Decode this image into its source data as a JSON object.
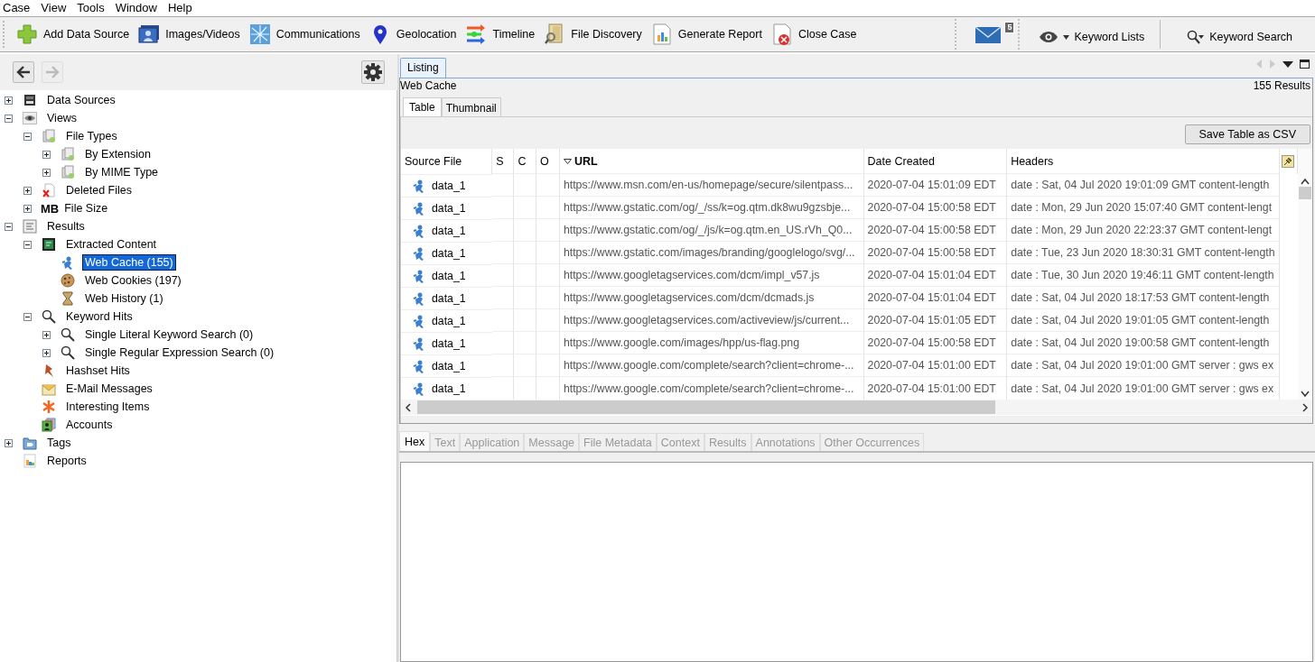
{
  "menu": [
    "Case",
    "View",
    "Tools",
    "Window",
    "Help"
  ],
  "toolbar": [
    {
      "label": "Add Data Source",
      "kind": "add"
    },
    {
      "label": "Images/Videos",
      "kind": "images"
    },
    {
      "label": "Communications",
      "kind": "comms"
    },
    {
      "label": "Geolocation",
      "kind": "pin"
    },
    {
      "label": "Timeline",
      "kind": "timeline"
    },
    {
      "label": "File Discovery",
      "kind": "discovery"
    },
    {
      "label": "Generate Report",
      "kind": "report"
    },
    {
      "label": "Close Case",
      "kind": "close"
    }
  ],
  "notifications": {
    "count": "5"
  },
  "keyword_lists": {
    "label": "Keyword Lists"
  },
  "keyword_search": {
    "label": "Keyword Search"
  },
  "nav": {
    "back": {
      "disabled": false
    },
    "forward": {
      "disabled": true
    }
  },
  "tree": [
    {
      "label": "Data Sources",
      "kind": "drive",
      "expanded": false,
      "selected": false
    },
    {
      "label": "Views",
      "kind": "eye",
      "expanded": true,
      "selected": false,
      "children": [
        {
          "label": "File Types",
          "kind": "filetypes",
          "expanded": true,
          "selected": false,
          "children": [
            {
              "label": "By Extension",
              "kind": "filetypes",
              "expanded": false,
              "selected": false
            },
            {
              "label": "By MIME Type",
              "kind": "filetypes",
              "expanded": false,
              "selected": false
            }
          ]
        },
        {
          "label": "Deleted Files",
          "kind": "deleted",
          "expanded": false,
          "selected": false
        },
        {
          "label": "File Size",
          "kind": "size",
          "badge": "MB",
          "expanded": false,
          "selected": false
        }
      ]
    },
    {
      "label": "Results",
      "kind": "results",
      "expanded": true,
      "selected": false,
      "children": [
        {
          "label": "Extracted Content",
          "kind": "extracted",
          "expanded": true,
          "selected": false,
          "children": [
            {
              "label": "Web Cache (155)",
              "kind": "webcache",
              "selected": true
            },
            {
              "label": "Web Cookies (197)",
              "kind": "cookie",
              "selected": false
            },
            {
              "label": "Web History (1)",
              "kind": "hourglass",
              "selected": false
            }
          ]
        },
        {
          "label": "Keyword Hits",
          "kind": "search",
          "expanded": true,
          "selected": false,
          "children": [
            {
              "label": "Single Literal Keyword Search (0)",
              "kind": "search",
              "expanded": false,
              "selected": false
            },
            {
              "label": "Single Regular Expression Search (0)",
              "kind": "search",
              "expanded": false,
              "selected": false
            }
          ]
        },
        {
          "label": "Hashset Hits",
          "kind": "pushpin",
          "selected": false
        },
        {
          "label": "E-Mail Messages",
          "kind": "mail",
          "selected": false
        },
        {
          "label": "Interesting Items",
          "kind": "asterisk",
          "selected": false
        },
        {
          "label": "Accounts",
          "kind": "accounts",
          "selected": false
        }
      ]
    },
    {
      "label": "Tags",
      "kind": "tags",
      "expanded": false,
      "selected": false
    },
    {
      "label": "Reports",
      "kind": "reports",
      "selected": false
    }
  ],
  "listing": {
    "tab": {
      "label": "Listing",
      "selected": true
    },
    "title": "Web Cache",
    "result_count": "155  Results",
    "view_tabs": [
      {
        "label": "Table",
        "selected": true
      },
      {
        "label": "Thumbnail",
        "selected": false
      }
    ],
    "save_button": "Save Table as CSV",
    "columns": [
      {
        "label": "Source File",
        "sorted": false
      },
      {
        "label": "S",
        "sorted": false
      },
      {
        "label": "C",
        "sorted": false
      },
      {
        "label": "O",
        "sorted": false
      },
      {
        "label": "URL",
        "sorted": true
      },
      {
        "label": "Date Created",
        "sorted": false
      },
      {
        "label": "Headers",
        "sorted": false
      }
    ],
    "rows": [
      {
        "source_file": "data_1",
        "url": "https://www.msn.com/en-us/homepage/secure/silentpass...",
        "date_created": "2020-07-04 15:01:09 EDT",
        "headers": "date : Sat, 04 Jul 2020 19:01:09 GMT content-length"
      },
      {
        "source_file": "data_1",
        "url": "https://www.gstatic.com/og/_/ss/k=og.qtm.dk8wu9gzsbje...",
        "date_created": "2020-07-04 15:00:58 EDT",
        "headers": "date : Mon, 29 Jun 2020 15:07:40 GMT content-lengt"
      },
      {
        "source_file": "data_1",
        "url": "https://www.gstatic.com/og/_/js/k=og.qtm.en_US.rVh_Q0...",
        "date_created": "2020-07-04 15:00:58 EDT",
        "headers": "date : Mon, 29 Jun 2020 22:23:37 GMT content-lengt"
      },
      {
        "source_file": "data_1",
        "url": "https://www.gstatic.com/images/branding/googlelogo/svg/...",
        "date_created": "2020-07-04 15:00:58 EDT",
        "headers": "date : Tue, 23 Jun 2020 18:30:31 GMT content-length"
      },
      {
        "source_file": "data_1",
        "url": "https://www.googletagservices.com/dcm/impl_v57.js",
        "date_created": "2020-07-04 15:01:04 EDT",
        "headers": "date : Tue, 30 Jun 2020 19:46:11 GMT content-length"
      },
      {
        "source_file": "data_1",
        "url": "https://www.googletagservices.com/dcm/dcmads.js",
        "date_created": "2020-07-04 15:01:04 EDT",
        "headers": "date : Sat, 04 Jul 2020 18:17:53 GMT content-length"
      },
      {
        "source_file": "data_1",
        "url": "https://www.googletagservices.com/activeview/js/current...",
        "date_created": "2020-07-04 15:01:05 EDT",
        "headers": "date : Sat, 04 Jul 2020 19:01:05 GMT content-length"
      },
      {
        "source_file": "data_1",
        "url": "https://www.google.com/images/hpp/us-flag.png",
        "date_created": "2020-07-04 15:00:58 EDT",
        "headers": "date : Sat, 04 Jul 2020 19:00:58 GMT content-length"
      },
      {
        "source_file": "data_1",
        "url": "https://www.google.com/complete/search?client=chrome-...",
        "date_created": "2020-07-04 15:01:00 EDT",
        "headers": "date : Sat, 04 Jul 2020 19:01:00 GMT server : gws ex"
      },
      {
        "source_file": "data_1",
        "url": "https://www.google.com/complete/search?client=chrome-...",
        "date_created": "2020-07-04 15:01:00 EDT",
        "headers": "date : Sat, 04 Jul 2020 19:01:00 GMT server : gws ex"
      }
    ]
  },
  "content_tabs": [
    {
      "label": "Hex",
      "selected": true,
      "disabled": false
    },
    {
      "label": "Text",
      "selected": false,
      "disabled": true
    },
    {
      "label": "Application",
      "selected": false,
      "disabled": true
    },
    {
      "label": "Message",
      "selected": false,
      "disabled": true
    },
    {
      "label": "File Metadata",
      "selected": false,
      "disabled": true
    },
    {
      "label": "Context",
      "selected": false,
      "disabled": true
    },
    {
      "label": "Results",
      "selected": false,
      "disabled": true
    },
    {
      "label": "Annotations",
      "selected": false,
      "disabled": true
    },
    {
      "label": "Other Occurrences",
      "selected": false,
      "disabled": true
    }
  ]
}
